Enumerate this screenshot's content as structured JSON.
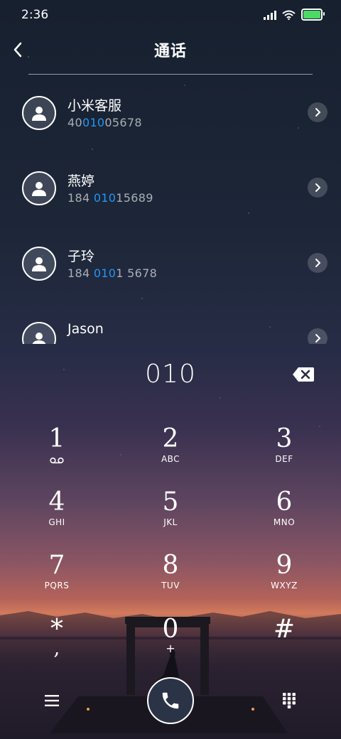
{
  "status_bar": {
    "time": "2:36",
    "battery_color": "#4cd964"
  },
  "header": {
    "title": "通话",
    "back_icon": "chevron-left-icon"
  },
  "contacts": [
    {
      "name": "小米客服",
      "number_pre": "40",
      "number_match": "010",
      "number_post": "05678"
    },
    {
      "name": "燕婷",
      "number_pre": "184 ",
      "number_match": "010",
      "number_post": "15689"
    },
    {
      "name": "子玲",
      "number_pre": "184 ",
      "number_match": "010",
      "number_post": "1 5678"
    },
    {
      "name": "Jason",
      "number_pre": "",
      "number_match": "",
      "number_post": ""
    }
  ],
  "highlight_color": "#2196f3",
  "dialer": {
    "input": "010",
    "keys": [
      {
        "digit": "1",
        "sub": ""
      },
      {
        "digit": "2",
        "sub": "ABC"
      },
      {
        "digit": "3",
        "sub": "DEF"
      },
      {
        "digit": "4",
        "sub": "GHI"
      },
      {
        "digit": "5",
        "sub": "JKL"
      },
      {
        "digit": "6",
        "sub": "MNO"
      },
      {
        "digit": "7",
        "sub": "PQRS"
      },
      {
        "digit": "8",
        "sub": "TUV"
      },
      {
        "digit": "9",
        "sub": "WXYZ"
      },
      {
        "digit": "*",
        "sub": ","
      },
      {
        "digit": "0",
        "sub": "+"
      },
      {
        "digit": "#",
        "sub": ""
      }
    ]
  },
  "bottom_bar": {
    "menu_icon": "menu-icon",
    "call_icon": "phone-icon",
    "keypad_icon": "keypad-icon"
  }
}
